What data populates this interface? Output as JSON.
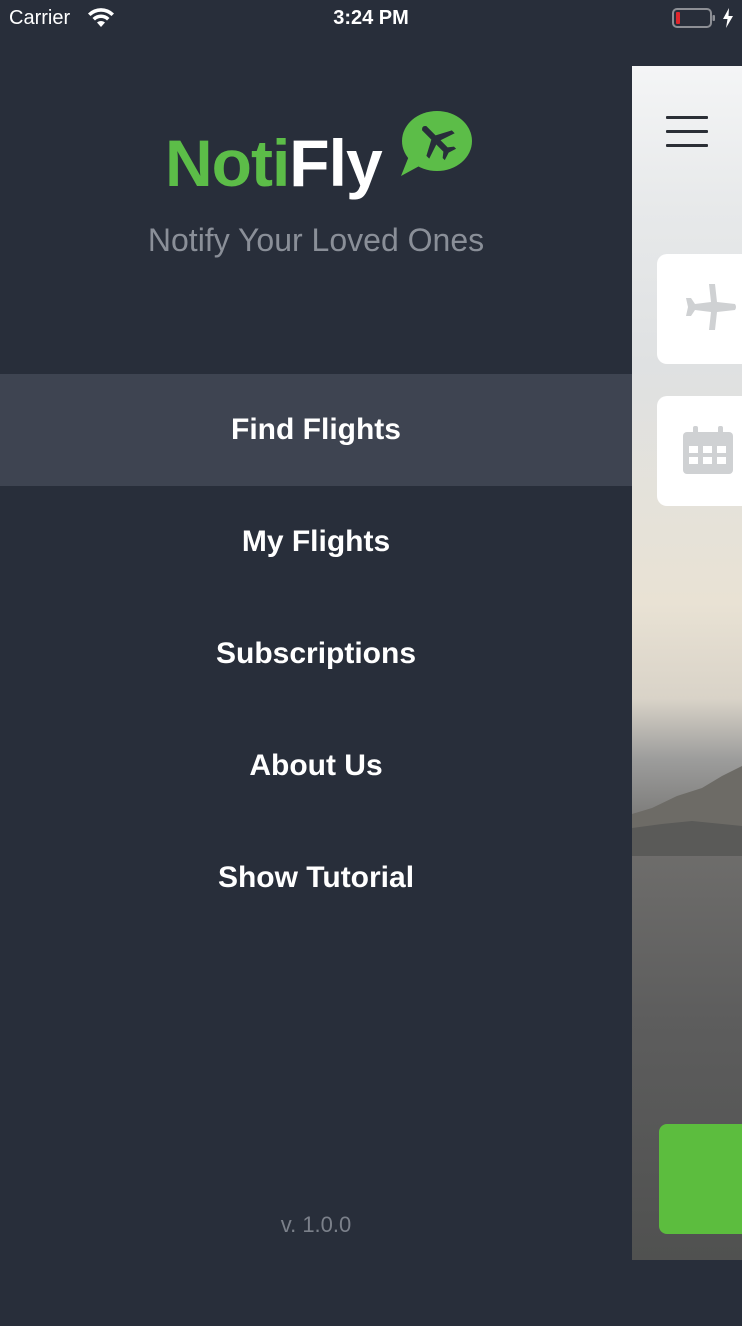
{
  "status_bar": {
    "carrier": "Carrier",
    "time": "3:24 PM",
    "icons": [
      "wifi-icon",
      "battery-low-icon",
      "charging-bolt-icon"
    ]
  },
  "drawer": {
    "logo": {
      "part1": "Noti",
      "part2": "Fly",
      "icon": "plane-speech-bubble-icon"
    },
    "tagline": "Notify Your Loved Ones",
    "menu": [
      {
        "label": "Find Flights",
        "active": true
      },
      {
        "label": "My Flights",
        "active": false
      },
      {
        "label": "Subscriptions",
        "active": false
      },
      {
        "label": "About Us",
        "active": false
      },
      {
        "label": "Show Tutorial",
        "active": false
      }
    ],
    "version": "v. 1.0.0"
  },
  "content": {
    "icons": [
      "hamburger-menu-icon",
      "airplane-icon",
      "calendar-icon"
    ]
  },
  "colors": {
    "drawer_bg": "#282e3a",
    "active_item_bg": "#3e4451",
    "brand_green": "#5cbd48",
    "tagline_gray": "#8a8f98"
  }
}
